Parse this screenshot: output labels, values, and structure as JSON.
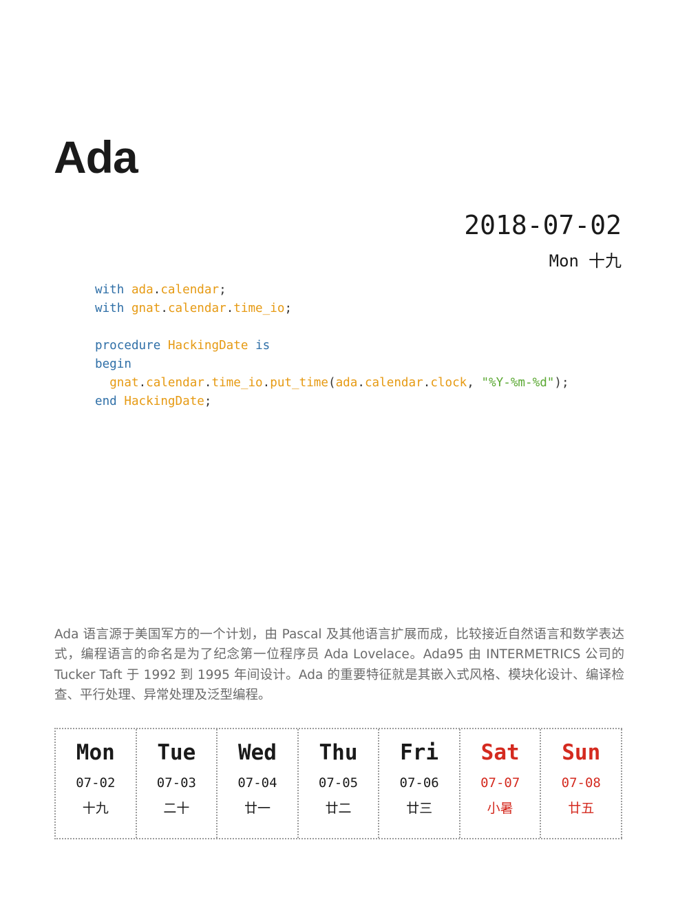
{
  "title": "Ada",
  "date": {
    "main": "2018-07-02",
    "weekday": "Mon",
    "lunar": "十九"
  },
  "code": {
    "lines": [
      [
        {
          "t": "kw",
          "v": "with"
        },
        {
          "t": "p",
          "v": " "
        },
        {
          "t": "id",
          "v": "ada"
        },
        {
          "t": "p",
          "v": "."
        },
        {
          "t": "id",
          "v": "calendar"
        },
        {
          "t": "p",
          "v": ";"
        }
      ],
      [
        {
          "t": "kw",
          "v": "with"
        },
        {
          "t": "p",
          "v": " "
        },
        {
          "t": "id",
          "v": "gnat"
        },
        {
          "t": "p",
          "v": "."
        },
        {
          "t": "id",
          "v": "calendar"
        },
        {
          "t": "p",
          "v": "."
        },
        {
          "t": "id",
          "v": "time_io"
        },
        {
          "t": "p",
          "v": ";"
        }
      ],
      [],
      [
        {
          "t": "kw",
          "v": "procedure"
        },
        {
          "t": "p",
          "v": " "
        },
        {
          "t": "id",
          "v": "HackingDate"
        },
        {
          "t": "p",
          "v": " "
        },
        {
          "t": "kw",
          "v": "is"
        }
      ],
      [
        {
          "t": "kw",
          "v": "begin"
        }
      ],
      [
        {
          "t": "p",
          "v": "  "
        },
        {
          "t": "id",
          "v": "gnat"
        },
        {
          "t": "p",
          "v": "."
        },
        {
          "t": "id",
          "v": "calendar"
        },
        {
          "t": "p",
          "v": "."
        },
        {
          "t": "id",
          "v": "time_io"
        },
        {
          "t": "p",
          "v": "."
        },
        {
          "t": "id",
          "v": "put_time"
        },
        {
          "t": "p",
          "v": "("
        },
        {
          "t": "id",
          "v": "ada"
        },
        {
          "t": "p",
          "v": "."
        },
        {
          "t": "id",
          "v": "calendar"
        },
        {
          "t": "p",
          "v": "."
        },
        {
          "t": "id",
          "v": "clock"
        },
        {
          "t": "p",
          "v": ", "
        },
        {
          "t": "str",
          "v": "\"%Y-%m-%d\""
        },
        {
          "t": "p",
          "v": ");"
        }
      ],
      [
        {
          "t": "kw",
          "v": "end"
        },
        {
          "t": "p",
          "v": " "
        },
        {
          "t": "id",
          "v": "HackingDate"
        },
        {
          "t": "p",
          "v": ";"
        }
      ]
    ]
  },
  "description": "Ada 语言源于美国军方的一个计划，由 Pascal 及其他语言扩展而成，比较接近自然语言和数学表达式，编程语言的命名是为了纪念第一位程序员 Ada Lovelace。Ada95 由 INTERMETRICS 公司的 Tucker Taft 于 1992 到 1995 年间设计。Ada 的重要特征就是其嵌入式风格、模块化设计、编译检查、平行处理、异常处理及泛型编程。",
  "week": [
    {
      "name": "Mon",
      "date": "07-02",
      "lunar": "十九",
      "weekend": false
    },
    {
      "name": "Tue",
      "date": "07-03",
      "lunar": "二十",
      "weekend": false
    },
    {
      "name": "Wed",
      "date": "07-04",
      "lunar": "廿一",
      "weekend": false
    },
    {
      "name": "Thu",
      "date": "07-05",
      "lunar": "廿二",
      "weekend": false
    },
    {
      "name": "Fri",
      "date": "07-06",
      "lunar": "廿三",
      "weekend": false
    },
    {
      "name": "Sat",
      "date": "07-07",
      "lunar": "小暑",
      "weekend": true
    },
    {
      "name": "Sun",
      "date": "07-08",
      "lunar": "廿五",
      "weekend": true
    }
  ],
  "colors": {
    "keyword": "#2f6fa7",
    "identifier": "#e69a13",
    "string": "#5aa832",
    "weekend": "#d42a1f"
  }
}
